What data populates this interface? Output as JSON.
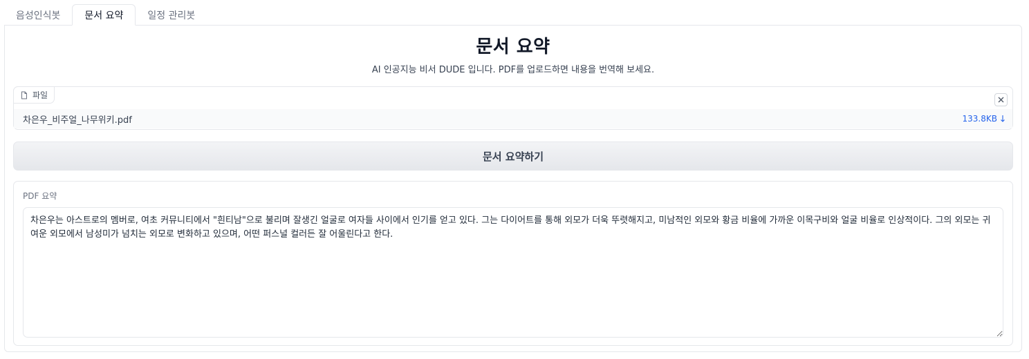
{
  "tabs": [
    {
      "label": "음성인식봇",
      "active": false
    },
    {
      "label": "문서 요약",
      "active": true
    },
    {
      "label": "일정 관리봇",
      "active": false
    }
  ],
  "header": {
    "title": "문서 요약",
    "subtitle": "AI 인공지능 비서 DUDE 입니다. PDF를 업로드하면 내용을 번역해 보세요."
  },
  "file_upload": {
    "label": "파일",
    "icon": "file-icon",
    "clear_icon": "close-icon",
    "file_name": "차은우_비주얼_나무위키.pdf",
    "file_size": "133.8KB",
    "download_icon": "download-icon"
  },
  "summarize_button": {
    "label": "문서 요약하기"
  },
  "output": {
    "label": "PDF 요약",
    "text": "차은우는 아스트로의 멤버로, 여초 커뮤니티에서 \"흰티남\"으로 불리며 잘생긴 얼굴로 여자들 사이에서 인기를 얻고 있다. 그는 다이어트를 통해 외모가 더욱 뚜렷해지고, 미남적인 외모와 황금 비율에 가까운 이목구비와 얼굴 비율로 인상적이다. 그의 외모는 귀여운 외모에서 남성미가 넘치는 외모로 변화하고 있으며, 어떤 퍼스널 컬러든 잘 어울린다고 한다."
  },
  "colors": {
    "accent_link": "#2563eb",
    "border": "#e5e7eb",
    "button_bg": "#e5e7eb"
  }
}
